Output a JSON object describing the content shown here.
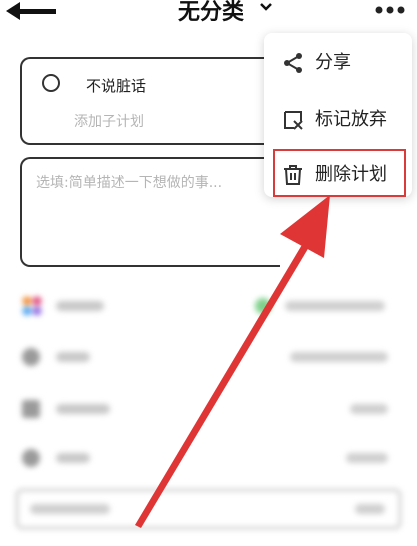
{
  "header": {
    "title": "无分类"
  },
  "plan": {
    "name": "不说脏话",
    "subplan_placeholder": "添加子计划"
  },
  "description": {
    "placeholder": "选填:简单描述一下想做的事..."
  },
  "menu": {
    "items": [
      {
        "label": "分享",
        "icon": "share-icon"
      },
      {
        "label": "标记放弃",
        "icon": "mark-abandon-icon"
      },
      {
        "label": "删除计划",
        "icon": "trash-icon"
      }
    ]
  },
  "colors": {
    "annotation_red": "#d93a3a",
    "placeholder_gray": "#b5b5b5"
  }
}
